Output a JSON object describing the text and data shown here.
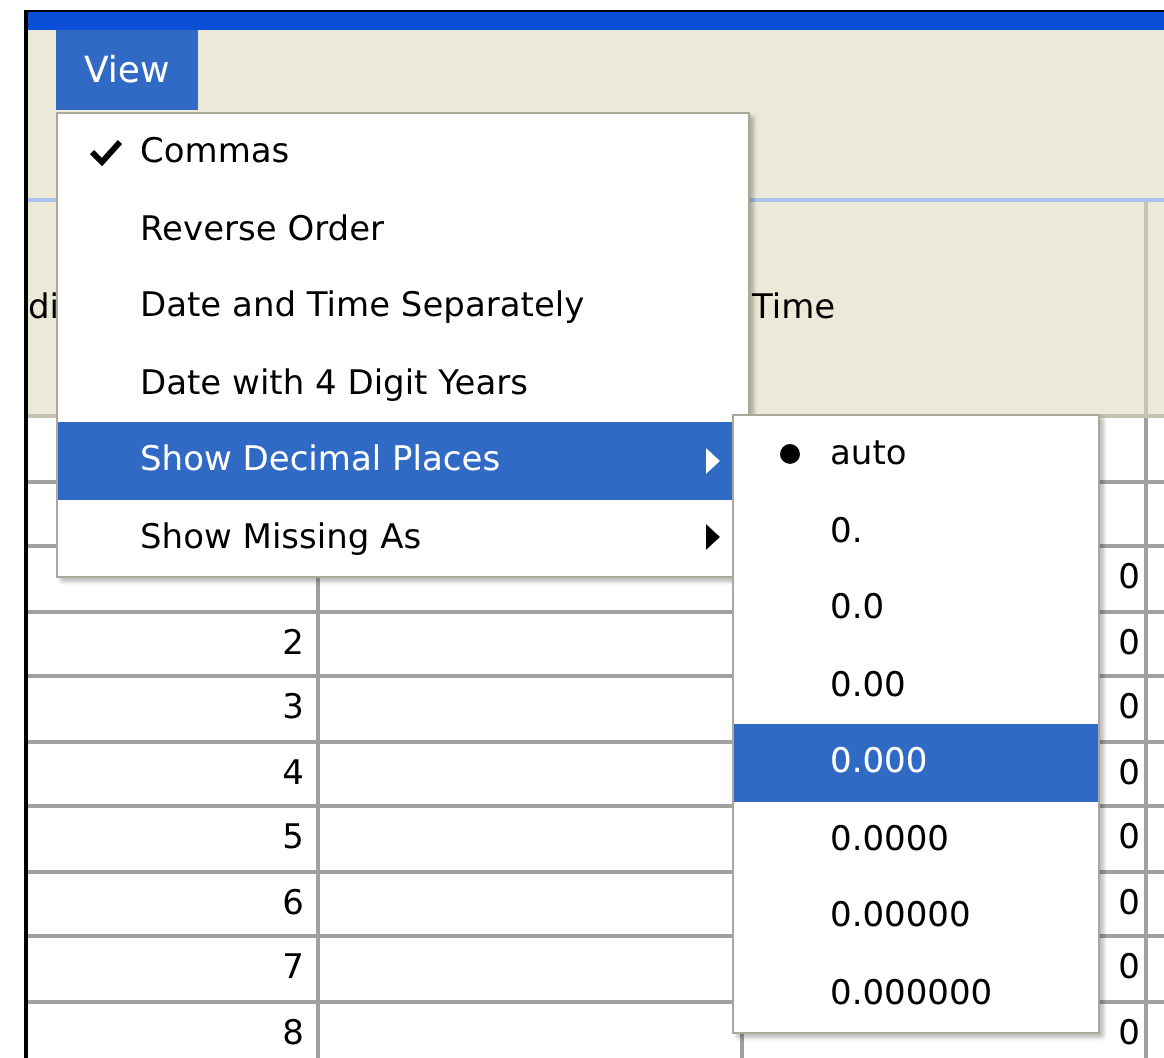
{
  "menubar": {
    "items": [
      {
        "label": "View",
        "selected": true
      }
    ]
  },
  "table": {
    "columns": [
      {
        "label": "di"
      },
      {
        "label": "Time"
      }
    ],
    "rows": [
      {
        "time": "0"
      },
      {
        "number": "2",
        "time": "0"
      },
      {
        "number": "3",
        "time": "0"
      },
      {
        "number": "4",
        "time": "0"
      },
      {
        "number": "5",
        "time": "0"
      },
      {
        "number": "6",
        "time": "0"
      },
      {
        "number": "7",
        "time": "0"
      },
      {
        "number": "8",
        "time": "0"
      }
    ]
  },
  "view_menu": {
    "items": [
      {
        "kind": "check",
        "label": "Commas",
        "checked": true,
        "highlighted": false
      },
      {
        "kind": "check",
        "label": "Reverse Order",
        "checked": false,
        "highlighted": false
      },
      {
        "kind": "check",
        "label": "Date and Time Separately",
        "checked": false,
        "highlighted": false
      },
      {
        "kind": "check",
        "label": "Date with 4 Digit Years",
        "checked": false,
        "highlighted": false
      },
      {
        "kind": "submenu",
        "label": "Show Decimal Places",
        "highlighted": true
      },
      {
        "kind": "submenu",
        "label": "Show Missing As",
        "highlighted": false
      }
    ]
  },
  "decimal_submenu": {
    "items": [
      {
        "label": "auto",
        "selected": true,
        "highlighted": false
      },
      {
        "label": "0.",
        "selected": false,
        "highlighted": false
      },
      {
        "label": "0.0",
        "selected": false,
        "highlighted": false
      },
      {
        "label": "0.00",
        "selected": false,
        "highlighted": false
      },
      {
        "label": "0.000",
        "selected": false,
        "highlighted": true
      },
      {
        "label": "0.0000",
        "selected": false,
        "highlighted": false
      },
      {
        "label": "0.00000",
        "selected": false,
        "highlighted": false
      },
      {
        "label": "0.000000",
        "selected": false,
        "highlighted": false
      }
    ]
  }
}
